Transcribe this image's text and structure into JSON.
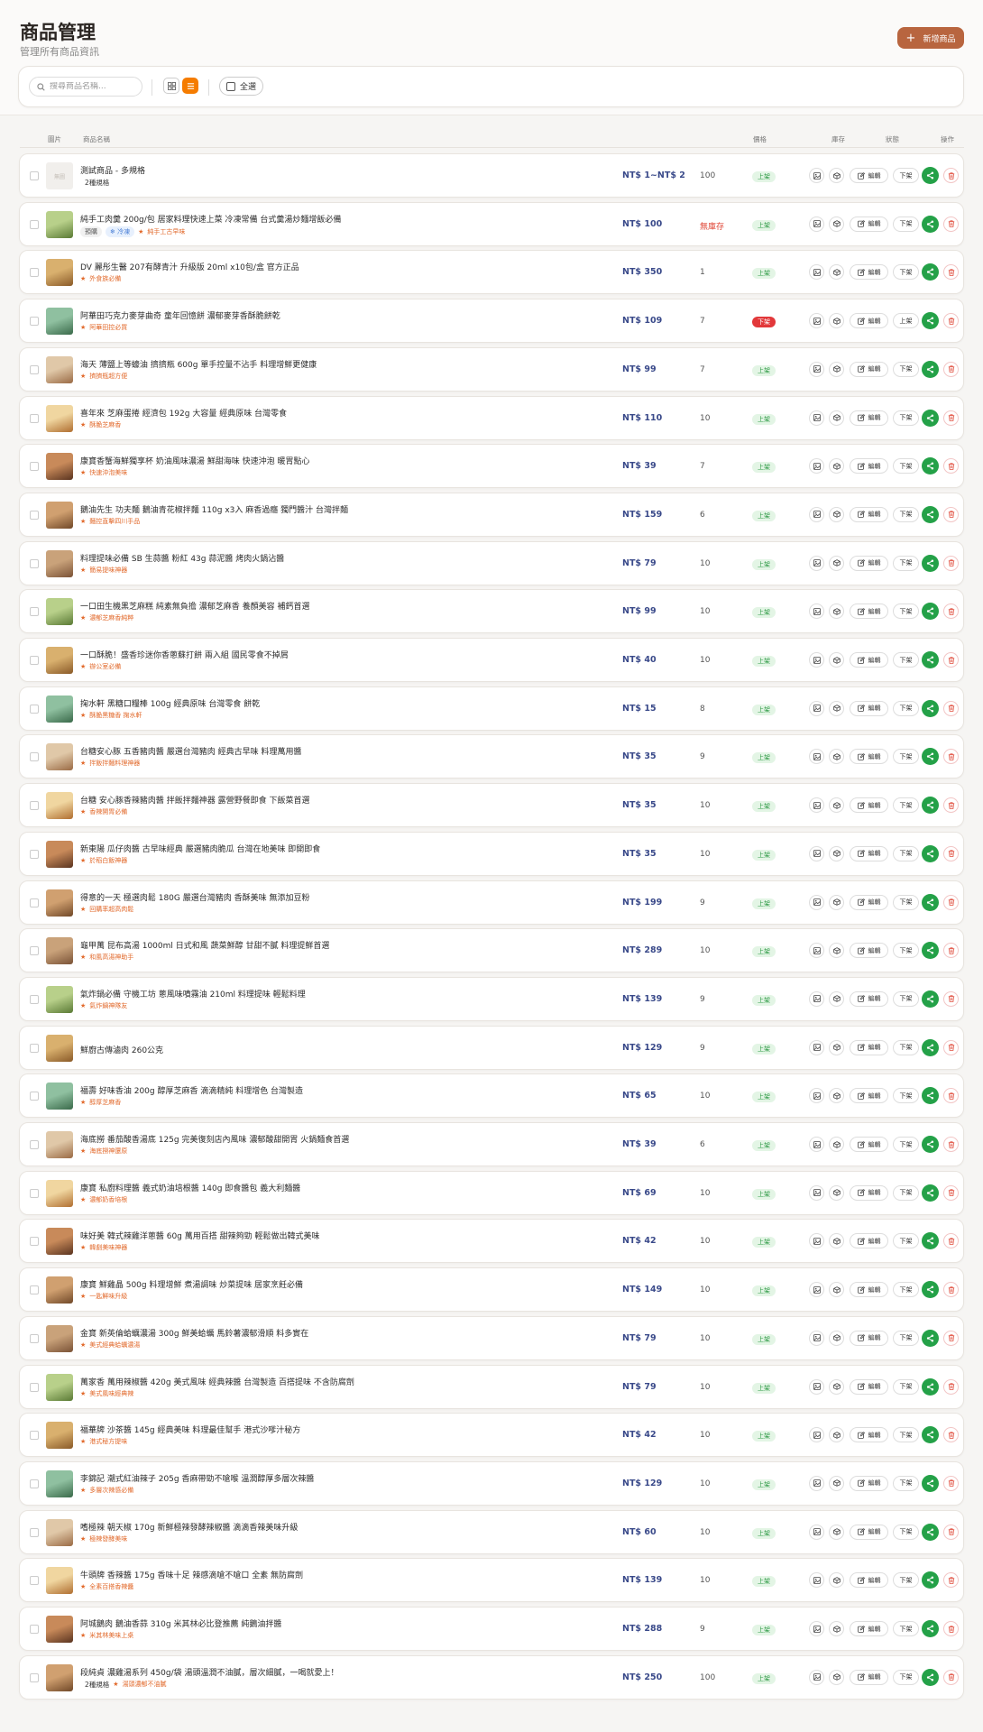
{
  "header": {
    "title": "商品管理",
    "subtitle": "管理所有商品資訊",
    "add_button": "新增商品"
  },
  "toolbar": {
    "search_placeholder": "搜尋商品名稱...",
    "select_all": "全選",
    "active_view": "list"
  },
  "columns": {
    "image": "圖片",
    "name": "商品名稱",
    "price": "價格",
    "stock": "庫存",
    "status": "狀態",
    "actions": "操作"
  },
  "row_actions": {
    "edit": "編輯",
    "unpublish": "下架",
    "publish": "上架"
  },
  "colors": {
    "brand": "#b8653f",
    "accent": "#f57c00",
    "price": "#3a4a8a",
    "status_on": "#2f9a46",
    "status_off": "#e2383a",
    "share": "#24a148"
  },
  "products": [
    {
      "name": "測試商品 - 多規格",
      "variant": "2種規格",
      "price": "NT$ 1~NT$ 2",
      "stock": "100",
      "status": "上架",
      "image": "placeholder",
      "placeholder": "無圖"
    },
    {
      "name": "純手工肉羹 200g/包 居家料理快速上菜 冷凍常備 台式羹湯炒麵增飯必備",
      "pills": [
        "預購",
        "❄ 冷凍"
      ],
      "tag": "純手工古早味",
      "price": "NT$ 100",
      "stock": "無庫存",
      "status": "上架",
      "image": "photo"
    },
    {
      "name": "DV 麗彤生醫 207有酵青汁 升級版 20ml x10包/盒 官方正品",
      "tag": "外食族必備",
      "price": "NT$ 350",
      "stock": "1",
      "status": "上架",
      "image": "photo"
    },
    {
      "name": "阿華田巧克力麥芽曲奇 童年回憶餅 濃郁麥芽香酥脆餅乾",
      "tag": "阿華田控必買",
      "price": "NT$ 109",
      "stock": "7",
      "status": "下架",
      "image": "photo"
    },
    {
      "name": "海天 薄鹽上等蠔油 擠擠瓶 600g 單手控量不沾手 料理增鮮更健康",
      "tag": "擠擠瓶超方便",
      "price": "NT$ 99",
      "stock": "7",
      "status": "上架",
      "image": "photo"
    },
    {
      "name": "喜年來 芝麻蛋捲 經濟包 192g 大容量 經典原味 台灣零食",
      "tag": "酥脆芝麻香",
      "price": "NT$ 110",
      "stock": "10",
      "status": "上架",
      "image": "photo"
    },
    {
      "name": "康寶香蟹海鮮獨享杯 奶油風味濃湯 鮮甜海味 快速沖泡 暖胃點心",
      "tag": "快速沖泡美味",
      "price": "NT$ 39",
      "stock": "7",
      "status": "上架",
      "image": "photo"
    },
    {
      "name": "鵝油先生 功夫麵 鵝油青花椒拌麵 110g x3入 麻香過癮 獨門醬汁 台灣拌麵",
      "tag": "麵控直擊四川手品",
      "price": "NT$ 159",
      "stock": "6",
      "status": "上架",
      "image": "photo"
    },
    {
      "name": "料理提味必備 SB 生蒜醬 粉紅 43g 蒜泥醬 烤肉火鍋沾醬",
      "tag": "簡易提味神器",
      "price": "NT$ 79",
      "stock": "10",
      "status": "上架",
      "image": "photo"
    },
    {
      "name": "一口田生機黑芝麻糕 純素無負擔 濃郁芝麻香 養顏美容 補鈣首選",
      "tag": "濃郁芝麻香純粹",
      "price": "NT$ 99",
      "stock": "10",
      "status": "上架",
      "image": "photo"
    },
    {
      "name": "一口酥脆！盛香珍迷你香蔥蘇打餅 兩入組 國民零食不掉屑",
      "tag": "辦公室必備",
      "price": "NT$ 40",
      "stock": "10",
      "status": "上架",
      "image": "photo"
    },
    {
      "name": "掬水軒 黑糖口糧棒 100g 經典原味 台灣零食 餅乾",
      "tag": "酥脆黑糖香 掬水軒",
      "price": "NT$ 15",
      "stock": "8",
      "status": "上架",
      "image": "photo"
    },
    {
      "name": "台糖安心豚 五香豬肉醬 嚴選台灣豬肉 經典古早味 料理萬用醬",
      "tag": "拌飯拌麵料理神器",
      "price": "NT$ 35",
      "stock": "9",
      "status": "上架",
      "image": "photo"
    },
    {
      "name": "台糖 安心豚香辣豬肉醬 拌飯拌麵神器 露營野餐即食 下飯菜首選",
      "tag": "香辣開胃必備",
      "price": "NT$ 35",
      "stock": "10",
      "status": "上架",
      "image": "photo"
    },
    {
      "name": "新東陽 瓜仔肉醬 古早味經典 嚴選豬肉脆瓜 台灣在地美味 即開即食",
      "tag": "於稻白飯神器",
      "price": "NT$ 35",
      "stock": "10",
      "status": "上架",
      "image": "photo"
    },
    {
      "name": "得意的一天 極選肉鬆 180G 嚴選台灣豬肉 香酥美味 無添加豆粉",
      "tag": "回購率超高肉鬆",
      "price": "NT$ 199",
      "stock": "9",
      "status": "上架",
      "image": "photo"
    },
    {
      "name": "龜甲萬 昆布高湯 1000ml 日式和風 蔬菜鮮醇 甘甜不膩 料理提鮮首選",
      "tag": "和風高湯神助手",
      "price": "NT$ 289",
      "stock": "10",
      "status": "上架",
      "image": "photo"
    },
    {
      "name": "氣炸鍋必備 守機工坊 蔥風味噴霧油 210ml 料理提味 輕鬆料理",
      "tag": "氣炸鍋神隊友",
      "price": "NT$ 139",
      "stock": "9",
      "status": "上架",
      "image": "photo"
    },
    {
      "name": "鮮廚古傳滷肉 260公克",
      "price": "NT$ 129",
      "stock": "9",
      "status": "上架",
      "image": "photo"
    },
    {
      "name": "福壽 好味香油 200g 醇厚芝麻香 滴滴精純 料理增色 台灣製造",
      "tag": "醇厚芝麻香",
      "price": "NT$ 65",
      "stock": "10",
      "status": "上架",
      "image": "photo"
    },
    {
      "name": "海底撈 番茄酸香湯底 125g 完美復刻店內風味 濃郁酸甜開胃 火鍋麵食首選",
      "tag": "海底撈神還原",
      "price": "NT$ 39",
      "stock": "6",
      "status": "上架",
      "image": "photo"
    },
    {
      "name": "康寶 私廚料理醬 義式奶油培根醬 140g 即食醬包 義大利麵醬",
      "tag": "濃郁奶香培根",
      "price": "NT$ 69",
      "stock": "10",
      "status": "上架",
      "image": "photo"
    },
    {
      "name": "味好美 韓式辣雞洋蔥醬 60g 萬用百搭 甜辣夠勁 輕鬆做出韓式美味",
      "tag": "韓劇美味神器",
      "price": "NT$ 42",
      "stock": "10",
      "status": "上架",
      "image": "photo"
    },
    {
      "name": "康寶 鮮雞晶 500g 料理增鮮 煮湯調味 炒菜提味 居家烹飪必備",
      "tag": "一匙鮮味升級",
      "price": "NT$ 149",
      "stock": "10",
      "status": "上架",
      "image": "photo"
    },
    {
      "name": "金寶 新英倫蛤蠣濃湯 300g 鮮美蛤蠣 馬鈴薯濃郁滑順 料多實在",
      "tag": "美式經典蛤蠣濃湯",
      "price": "NT$ 79",
      "stock": "10",
      "status": "上架",
      "image": "photo"
    },
    {
      "name": "萬家香 萬用辣椒醬 420g 美式風味 經典辣醬 台灣製造 百搭提味 不含防腐劑",
      "tag": "美式風味經典辣",
      "price": "NT$ 79",
      "stock": "10",
      "status": "上架",
      "image": "photo"
    },
    {
      "name": "福華牌 沙茶醬 145g 經典美味 料理最佳幫手 港式沙嗲汁秘方",
      "tag": "港式秘方提味",
      "price": "NT$ 42",
      "stock": "10",
      "status": "上架",
      "image": "photo"
    },
    {
      "name": "李錦記 潮式紅油辣子 205g 香麻帶勁不嗆喉 溫潤醇厚多層次辣醬",
      "tag": "多層次辣感必備",
      "price": "NT$ 129",
      "stock": "10",
      "status": "上架",
      "image": "photo"
    },
    {
      "name": "嗜極辣 朝天椒 170g 新鮮極辣發酵辣椒醬 滴滴香辣美味升級",
      "tag": "極辣發酵美味",
      "price": "NT$ 60",
      "stock": "10",
      "status": "上架",
      "image": "photo"
    },
    {
      "name": "牛頭牌 香辣醬 175g 香味十足 辣感滴嗆不嗆口 全素 無防腐劑",
      "tag": "全素百搭香辣醬",
      "price": "NT$ 139",
      "stock": "10",
      "status": "上架",
      "image": "photo"
    },
    {
      "name": "阿城鵝肉 鵝油香蒜 310g 米其林必比登推薦 純鵝油拌醬",
      "tag": "米其林美味上桌",
      "price": "NT$ 288",
      "stock": "9",
      "status": "上架",
      "image": "photo"
    },
    {
      "name": "段純貞 濃雞湯系列 450g/袋 湯頭溫潤不油膩，層次細膩，一喝就愛上！",
      "variant": "2種規格",
      "tag": "湯頭濃郁不油膩",
      "price": "NT$ 250",
      "stock": "100",
      "status": "上架",
      "image": "photo"
    }
  ]
}
